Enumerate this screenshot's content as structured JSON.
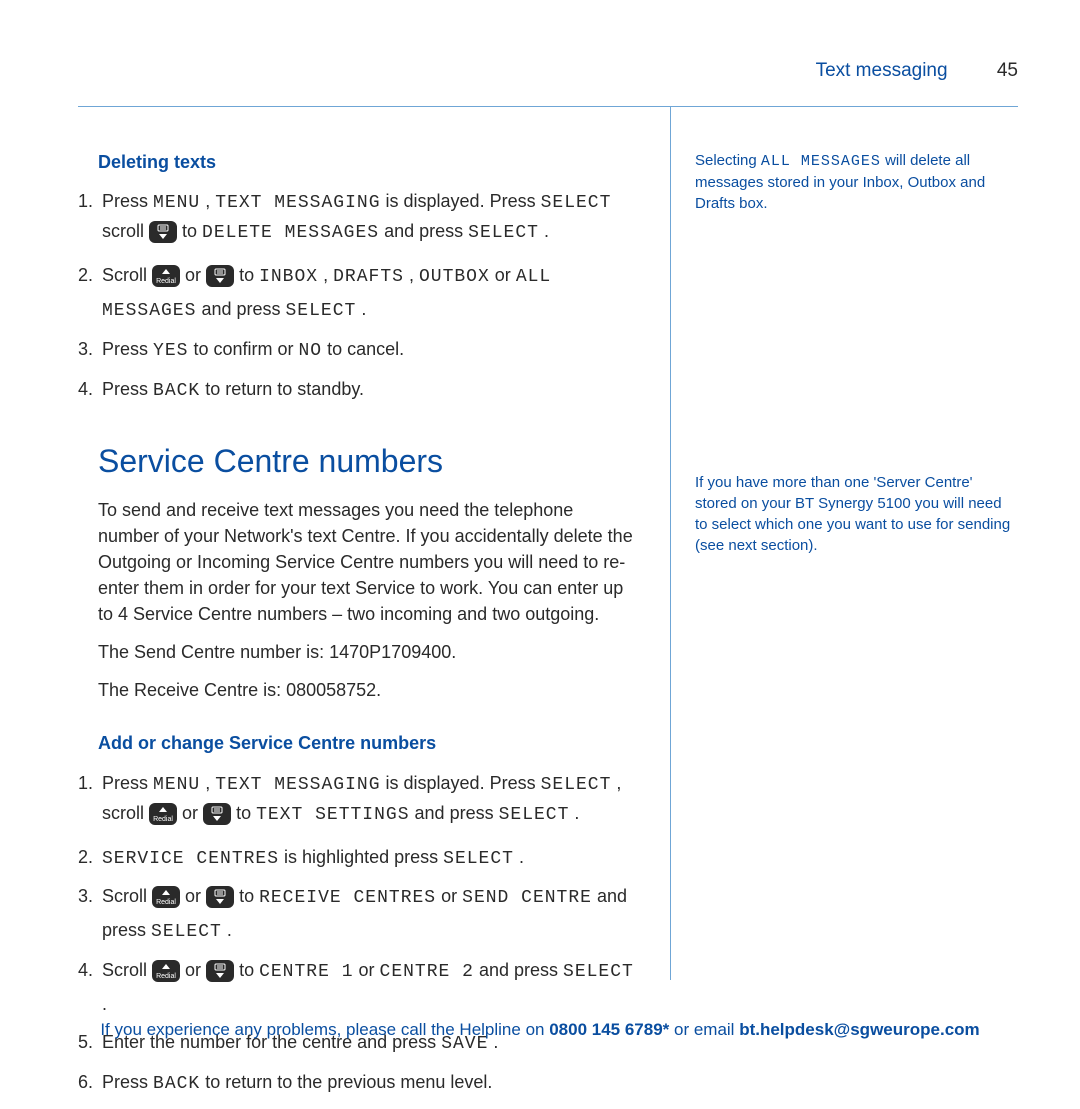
{
  "header": {
    "title": "Text messaging",
    "page": "45"
  },
  "section1": {
    "heading": "Deleting texts",
    "items": {
      "i1a": "Press ",
      "i1b": "MENU",
      "i1c": ", ",
      "i1d": "TEXT MESSAGING",
      "i1e": " is displayed. Press ",
      "i1f": "SELECT",
      "i1g": " scroll ",
      "i1h": " to ",
      "i1i": "DELETE MESSAGES",
      "i1j": " and press ",
      "i1k": "SELECT",
      "i1l": ".",
      "i2a": "Scroll ",
      "i2b": " or ",
      "i2c": " to ",
      "i2d": "INBOX",
      "i2e": ", ",
      "i2f": "DRAFTS",
      "i2g": ", ",
      "i2h": "OUTBOX",
      "i2i": " or ",
      "i2j": "ALL MESSAGES",
      "i2k": " and press ",
      "i2l": "SELECT",
      "i2m": ".",
      "i3a": "Press ",
      "i3b": "YES",
      "i3c": " to confirm or ",
      "i3d": "NO",
      "i3e": " to cancel.",
      "i4a": "Press ",
      "i4b": "BACK",
      "i4c": " to return to standby."
    }
  },
  "section2": {
    "heading": "Service Centre numbers",
    "p1": "To send and receive text messages you need the telephone number of your Network's text Centre. If you accidentally delete the Outgoing or Incoming Service Centre numbers you will need to re-enter them in order for your text Service to work. You can enter up to 4 Service Centre numbers – two incoming and two outgoing.",
    "p2": "The Send Centre number is: 1470P1709400.",
    "p3": "The Receive Centre is: 080058752."
  },
  "section3": {
    "heading": "Add or change Service Centre numbers",
    "items": {
      "j1a": "Press ",
      "j1b": "MENU",
      "j1c": ", ",
      "j1d": "TEXT MESSAGING",
      "j1e": " is displayed. Press ",
      "j1f": "SELECT",
      "j1g": ", scroll ",
      "j1h": " or ",
      "j1i": " to ",
      "j1j": "TEXT SETTINGS",
      "j1k": " and press ",
      "j1l": "SELECT",
      "j1m": ".",
      "j2a": "SERVICE CENTRES",
      "j2b": " is highlighted press ",
      "j2c": "SELECT",
      "j2d": ".",
      "j3a": "Scroll ",
      "j3b": " or ",
      "j3c": " to ",
      "j3d": "RECEIVE CENTRES",
      "j3e": " or ",
      "j3f": "SEND CENTRE",
      "j3g": " and press ",
      "j3h": "SELECT",
      "j3i": ".",
      "j4a": "Scroll ",
      "j4b": " or ",
      "j4c": " to ",
      "j4d": "CENTRE 1",
      "j4e": " or ",
      "j4f": "CENTRE 2",
      "j4g": " and press ",
      "j4h": "SELECT",
      "j4i": ".",
      "j5a": "Enter the number for the centre and press ",
      "j5b": "SAVE",
      "j5c": ".",
      "j6a": "Press ",
      "j6b": "BACK",
      "j6c": " to return to the previous menu level."
    }
  },
  "sidebar": {
    "n1a": "Selecting ",
    "n1b": "ALL MESSAGES",
    "n1c": " will delete all messages stored in your Inbox, Outbox and Drafts box.",
    "n2": "If you have more than one 'Server Centre' stored on your BT Synergy 5100 you will need to select which one you want to use for sending (see next section)."
  },
  "footer": {
    "t1": "If you experience any problems, please call the Helpline on ",
    "t2": "0800 145 6789*",
    "t3": " or email ",
    "t4": "bt.helpdesk@sgweurope.com"
  },
  "icons": {
    "up": "redial-up-key",
    "down": "phonebook-down-key"
  }
}
